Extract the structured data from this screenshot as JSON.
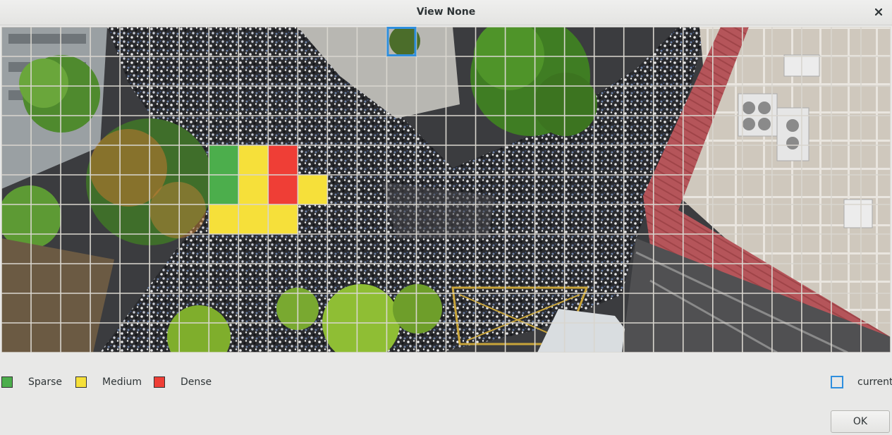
{
  "window": {
    "title": "View None",
    "close_icon": "close-icon"
  },
  "density_grid": {
    "columns": 30,
    "rows": 11,
    "cells": [
      {
        "col": 7,
        "row": 4,
        "level": "sparse"
      },
      {
        "col": 8,
        "row": 4,
        "level": "medium"
      },
      {
        "col": 9,
        "row": 4,
        "level": "dense"
      },
      {
        "col": 7,
        "row": 5,
        "level": "sparse"
      },
      {
        "col": 8,
        "row": 5,
        "level": "medium"
      },
      {
        "col": 9,
        "row": 5,
        "level": "dense"
      },
      {
        "col": 10,
        "row": 5,
        "level": "medium"
      },
      {
        "col": 7,
        "row": 6,
        "level": "medium"
      },
      {
        "col": 8,
        "row": 6,
        "level": "medium"
      },
      {
        "col": 9,
        "row": 6,
        "level": "medium"
      }
    ],
    "current_cell": {
      "col": 13,
      "row": 0
    }
  },
  "colors": {
    "sparse": "#4cae4c",
    "medium": "#f6e03a",
    "dense": "#ef3e36",
    "current": "#2f8fde",
    "grid": "#d9d6cf"
  },
  "legend": {
    "sparse_label": "Sparse",
    "medium_label": "Medium",
    "dense_label": "Dense",
    "current_label": "current"
  },
  "buttons": {
    "ok_label": "OK"
  }
}
